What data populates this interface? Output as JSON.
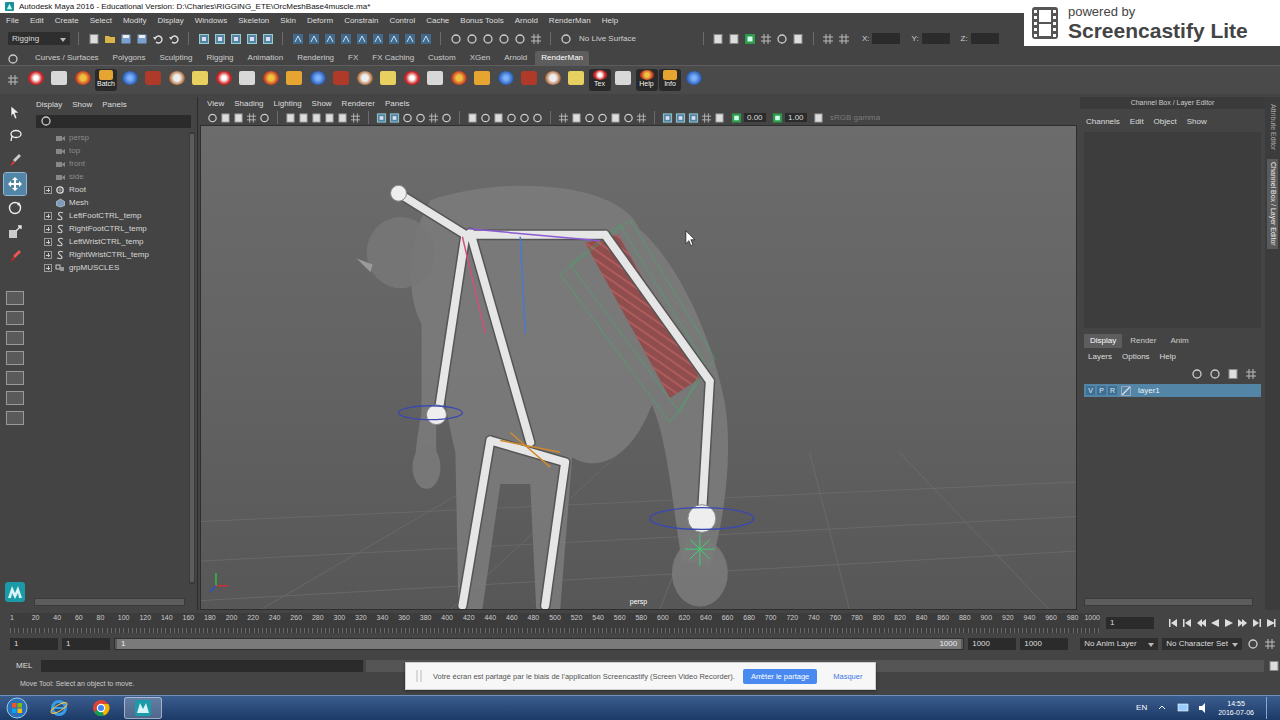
{
  "window": {
    "title": "Autodesk Maya 2016 - Educational Version: D:\\Charles\\RIGGING_ETE\\OrcMeshBase4muscle.ma*"
  },
  "watermark": {
    "line1": "powered by",
    "line2": "Screencastify Lite"
  },
  "menubar": [
    "File",
    "Edit",
    "Create",
    "Select",
    "Modify",
    "Display",
    "Windows",
    "Skeleton",
    "Skin",
    "Deform",
    "Constrain",
    "Control",
    "Cache",
    "Bonus Tools",
    "Arnold",
    "RenderMan",
    "Help"
  ],
  "status_line": {
    "menu_set": "Rigging",
    "live_surface": "No Live Surface",
    "fields": [
      "X:",
      "Y:",
      "Z:"
    ]
  },
  "shelf": {
    "tabs": [
      {
        "label": "Curves / Surfaces",
        "selected": false
      },
      {
        "label": "Polygons",
        "selected": false
      },
      {
        "label": "Sculpting",
        "selected": false
      },
      {
        "label": "Rigging",
        "selected": false
      },
      {
        "label": "Animation",
        "selected": false
      },
      {
        "label": "Rendering",
        "selected": false
      },
      {
        "label": "FX",
        "selected": false
      },
      {
        "label": "FX Caching",
        "selected": false
      },
      {
        "label": "Custom",
        "selected": false
      },
      {
        "label": "XGen",
        "selected": false
      },
      {
        "label": "Arnold",
        "selected": false
      },
      {
        "label": "RenderMan",
        "selected": true
      }
    ],
    "items": [
      {
        "kind": "plain"
      },
      {
        "kind": "plain"
      },
      {
        "kind": "plain"
      },
      {
        "kind": "labeled",
        "label": "Batch"
      },
      {
        "kind": "plain"
      },
      {
        "kind": "plain"
      },
      {
        "kind": "plain"
      },
      {
        "kind": "plain"
      },
      {
        "kind": "plain"
      },
      {
        "kind": "plain"
      },
      {
        "kind": "plain"
      },
      {
        "kind": "plain"
      },
      {
        "kind": "plain"
      },
      {
        "kind": "plain"
      },
      {
        "kind": "plain"
      },
      {
        "kind": "plain"
      },
      {
        "kind": "plain"
      },
      {
        "kind": "plain"
      },
      {
        "kind": "plain"
      },
      {
        "kind": "plain"
      },
      {
        "kind": "plain"
      },
      {
        "kind": "plain"
      },
      {
        "kind": "plain"
      },
      {
        "kind": "plain"
      },
      {
        "kind": "labeled",
        "label": "Tex"
      },
      {
        "kind": "plain"
      },
      {
        "kind": "labeled",
        "label": "Help"
      },
      {
        "kind": "labeled",
        "label": "Info"
      },
      {
        "kind": "plain"
      }
    ]
  },
  "toolbox": {
    "tools": [
      {
        "kind": "select",
        "selected": false
      },
      {
        "kind": "lasso",
        "selected": false
      },
      {
        "kind": "paint",
        "selected": false
      },
      {
        "kind": "move",
        "selected": true
      },
      {
        "kind": "rotate",
        "selected": false
      },
      {
        "kind": "scale",
        "selected": false
      },
      {
        "kind": "last",
        "selected": false
      }
    ]
  },
  "outliner": {
    "menu": [
      "Display",
      "Show",
      "Panels"
    ],
    "items": [
      {
        "label": "persp",
        "kind": "camera",
        "expandable": false,
        "dimmed": true
      },
      {
        "label": "top",
        "kind": "camera",
        "expandable": false,
        "dimmed": true
      },
      {
        "label": "front",
        "kind": "camera",
        "expandable": false,
        "dimmed": true
      },
      {
        "label": "side",
        "kind": "camera",
        "expandable": false,
        "dimmed": true
      },
      {
        "label": "Root",
        "kind": "joint",
        "expandable": true,
        "dimmed": false
      },
      {
        "label": "Mesh",
        "kind": "mesh",
        "expandable": false,
        "dimmed": false
      },
      {
        "label": "LeftFootCTRL_temp",
        "kind": "curve",
        "expandable": true,
        "dimmed": false
      },
      {
        "label": "RightFootCTRL_temp",
        "kind": "curve",
        "expandable": true,
        "dimmed": false
      },
      {
        "label": "LeftWristCTRL_temp",
        "kind": "curve",
        "expandable": true,
        "dimmed": false
      },
      {
        "label": "RightWristCTRL_temp",
        "kind": "curve",
        "expandable": true,
        "dimmed": false
      },
      {
        "label": "grpMUSCLES",
        "kind": "group",
        "expandable": true,
        "dimmed": false
      }
    ]
  },
  "viewport": {
    "menu": [
      "View",
      "Shading",
      "Lighting",
      "Show",
      "Renderer",
      "Panels"
    ],
    "exposure": "0.00",
    "gamma": "1.00",
    "view_transform": "sRGB gamma",
    "camera": "persp"
  },
  "channel_box": {
    "title": "Channel Box / Layer Editor",
    "menu": [
      "Channels",
      "Edit",
      "Object",
      "Show"
    ]
  },
  "side_tabs": [
    {
      "label": "Attribute Editor",
      "selected": false
    },
    {
      "label": "Channel Box / Layer Editor",
      "selected": true
    }
  ],
  "layer_editor": {
    "tabs": [
      {
        "label": "Display",
        "selected": true
      },
      {
        "label": "Render",
        "selected": false
      },
      {
        "label": "Anim",
        "selected": false
      }
    ],
    "menu": [
      "Layers",
      "Options",
      "Help"
    ],
    "layers": [
      {
        "flags": [
          "V",
          "P",
          "R"
        ],
        "name": "layer1",
        "selected": true
      }
    ]
  },
  "timeline": {
    "ticks": [
      "1",
      "20",
      "40",
      "60",
      "80",
      "100",
      "120",
      "140",
      "160",
      "180",
      "200",
      "220",
      "240",
      "260",
      "280",
      "300",
      "320",
      "340",
      "360",
      "380",
      "400",
      "420",
      "440",
      "460",
      "480",
      "500",
      "520",
      "540",
      "560",
      "580",
      "600",
      "620",
      "640",
      "660",
      "680",
      "700",
      "720",
      "740",
      "760",
      "780",
      "800",
      "820",
      "840",
      "860",
      "880",
      "900",
      "920",
      "940",
      "960",
      "980",
      "1000"
    ],
    "current_frame": "1"
  },
  "range": {
    "start": "1",
    "playback_start": "1",
    "slider_start": "1",
    "slider_end": "1000",
    "playback_end": "1000",
    "end": "1000",
    "anim_layer": "No Anim Layer",
    "character_set": "No Character Set"
  },
  "command_line": {
    "language": "MEL"
  },
  "help_line": "Move Tool: Select an object to move.",
  "notification": {
    "text": "Votre écran est partagé par le biais de l'application Screencastify (Screen Video Recorder).",
    "buttons": [
      {
        "label": "Arrêter le partage",
        "primary": true
      },
      {
        "label": "Masquer",
        "primary": false
      }
    ]
  },
  "taskbar": {
    "apps": [
      {
        "kind": "ie",
        "active": false
      },
      {
        "kind": "chrome",
        "active": false
      },
      {
        "kind": "maya",
        "active": true
      }
    ],
    "language": "EN",
    "time": "14:55",
    "date": "2016-07-06"
  }
}
